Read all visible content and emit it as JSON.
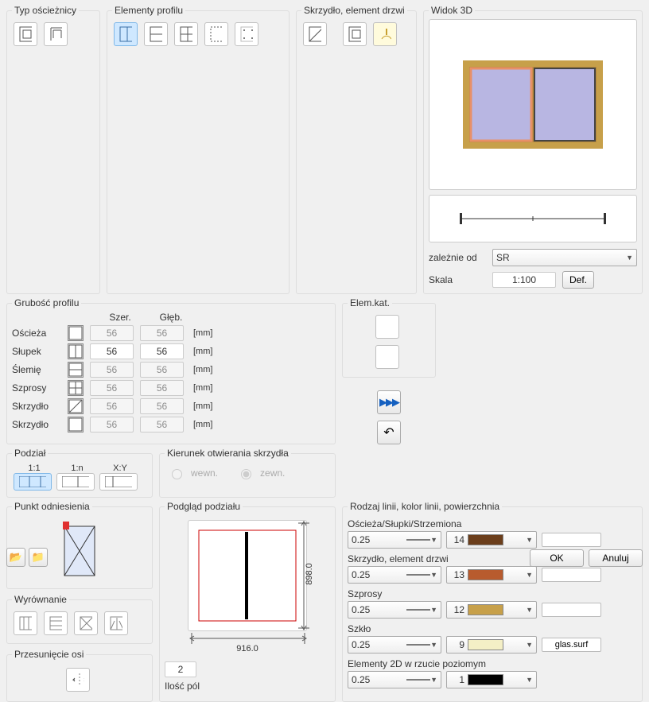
{
  "typeOscieznicy": {
    "label": "Typ ościeżnicy"
  },
  "elementyProfilu": {
    "label": "Elementy profilu"
  },
  "skrzydlo": {
    "label": "Skrzydło, element drzwi"
  },
  "widok3d": {
    "label": "Widok 3D"
  },
  "grubosc": {
    "label": "Grubość profilu",
    "col1": "Szer.",
    "col2": "Głęb.",
    "rows": [
      {
        "name": "Ościeża",
        "szer": "56",
        "gleb": "56",
        "unit": "[mm]",
        "enabled": false
      },
      {
        "name": "Słupek",
        "szer": "56",
        "gleb": "56",
        "unit": "[mm]",
        "enabled": true
      },
      {
        "name": "Ślemię",
        "szer": "56",
        "gleb": "56",
        "unit": "[mm]",
        "enabled": false
      },
      {
        "name": "Szprosy",
        "szer": "56",
        "gleb": "56",
        "unit": "[mm]",
        "enabled": false
      },
      {
        "name": "Skrzydło",
        "szer": "56",
        "gleb": "56",
        "unit": "[mm]",
        "enabled": false
      },
      {
        "name": "Skrzydło",
        "szer": "56",
        "gleb": "56",
        "unit": "[mm]",
        "enabled": false
      }
    ]
  },
  "elemKat": {
    "label": "Elem.kat."
  },
  "podzial": {
    "label": "Podział",
    "opts": [
      "1:1",
      "1:n",
      "X:Y"
    ]
  },
  "kierunek": {
    "label": "Kierunek otwierania skrzydła",
    "wewn": "wewn.",
    "zewn": "zewn."
  },
  "punktOdniesienia": {
    "label": "Punkt odniesienia"
  },
  "wyrownanie": {
    "label": "Wyrównanie"
  },
  "przesuniecieOsi": {
    "label": "Przesunięcie osi"
  },
  "podgladPodzialu": {
    "label": "Podgląd podziału",
    "width": "916.0",
    "height": "898.0",
    "iloscPolLabel": "Ilość pól",
    "iloscPol": "2"
  },
  "zaleznieOd": {
    "label": "zależnie od",
    "value": "SR"
  },
  "skala": {
    "label": "Skala",
    "value": "1:100",
    "def": "Def."
  },
  "rodzajLinii": {
    "label": "Rodzaj linii, kolor linii, powierzchnia",
    "rows": [
      {
        "title": "Ościeża/Słupki/Strzemiona",
        "weight": "0.25",
        "color_idx": "14",
        "swatch": "#6b3e1b",
        "surf": ""
      },
      {
        "title": "Skrzydło, element drzwi",
        "weight": "0.25",
        "color_idx": "13",
        "swatch": "#b85b2e",
        "surf": ""
      },
      {
        "title": "Szprosy",
        "weight": "0.25",
        "color_idx": "12",
        "swatch": "#c7a04a",
        "surf": ""
      },
      {
        "title": "Szkło",
        "weight": "0.25",
        "color_idx": "9",
        "swatch": "#f4efc6",
        "surf": "glas.surf"
      },
      {
        "title": "Elementy 2D w rzucie poziomym",
        "weight": "0.25",
        "color_idx": "1",
        "swatch": "#000000",
        "surf": null
      }
    ]
  },
  "buttons": {
    "ok": "OK",
    "cancel": "Anuluj"
  },
  "chart_data": {
    "type": "diagram",
    "note": "3D preview of a two-pane window; left pane highlighted orange, right blue; frame wood-colored",
    "frame_color": "#b88a3a",
    "glass_color": "#b8b6e2",
    "highlight_color": "#e89068"
  }
}
